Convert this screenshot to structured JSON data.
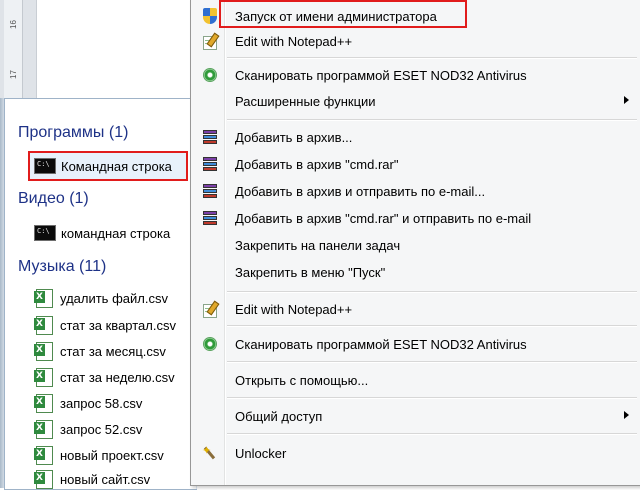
{
  "ruler": {
    "numbers": [
      "16",
      "17"
    ]
  },
  "start_menu": {
    "groups": [
      {
        "title": "Программы (1)",
        "items": [
          {
            "label": "Командная строка",
            "icon": "cmd-icon"
          }
        ]
      },
      {
        "title": "Видео (1)",
        "items": [
          {
            "label": "командная строка",
            "icon": "cmd-icon"
          }
        ]
      },
      {
        "title": "Музыка (11)",
        "items": [
          {
            "label": "удалить файл.csv",
            "icon": "csv-excel-icon"
          },
          {
            "label": "стат за квартал.csv",
            "icon": "csv-excel-icon"
          },
          {
            "label": "стат за месяц.csv",
            "icon": "csv-excel-icon"
          },
          {
            "label": "стат за неделю.csv",
            "icon": "csv-excel-icon"
          },
          {
            "label": "запрос 58.csv",
            "icon": "csv-excel-icon"
          },
          {
            "label": "запрос 52.csv",
            "icon": "csv-excel-icon"
          },
          {
            "label": "новый проект.csv",
            "icon": "csv-excel-icon"
          },
          {
            "label": "новый сайт.csv",
            "icon": "csv-excel-icon"
          }
        ]
      }
    ]
  },
  "context_menu": {
    "items": [
      {
        "label": "Запуск от имени администратора",
        "icon": "uac-shield-icon",
        "submenu": false
      },
      {
        "label": "Edit with Notepad++",
        "icon": "notepad-plus-plus-icon",
        "submenu": false
      },
      {
        "label": "Сканировать программой ESET NOD32 Antivirus",
        "icon": "eset-icon",
        "submenu": false
      },
      {
        "label": "Расширенные функции",
        "icon": "",
        "submenu": true
      },
      {
        "label": "Добавить в архив...",
        "icon": "winrar-icon",
        "submenu": false
      },
      {
        "label": "Добавить в архив \"cmd.rar\"",
        "icon": "winrar-icon",
        "submenu": false
      },
      {
        "label": "Добавить в архив и отправить по e-mail...",
        "icon": "winrar-icon",
        "submenu": false
      },
      {
        "label": "Добавить в архив \"cmd.rar\" и отправить по e-mail",
        "icon": "winrar-icon",
        "submenu": false
      },
      {
        "label": "Закрепить на панели задач",
        "icon": "",
        "submenu": false
      },
      {
        "label": "Закрепить в меню \"Пуск\"",
        "icon": "",
        "submenu": false
      },
      {
        "label": "Edit with Notepad++",
        "icon": "notepad-plus-plus-icon",
        "submenu": false
      },
      {
        "label": "Сканировать программой ESET NOD32 Antivirus",
        "icon": "eset-icon",
        "submenu": false
      },
      {
        "label": "Открыть с помощью...",
        "icon": "",
        "submenu": false
      },
      {
        "label": "Общий доступ",
        "icon": "",
        "submenu": true
      },
      {
        "label": "Unlocker",
        "icon": "unlocker-icon",
        "submenu": false
      }
    ]
  },
  "colors": {
    "highlight_border": "#e11c1c",
    "group_title": "#1e3287",
    "menu_background": "#f5f6f7"
  }
}
